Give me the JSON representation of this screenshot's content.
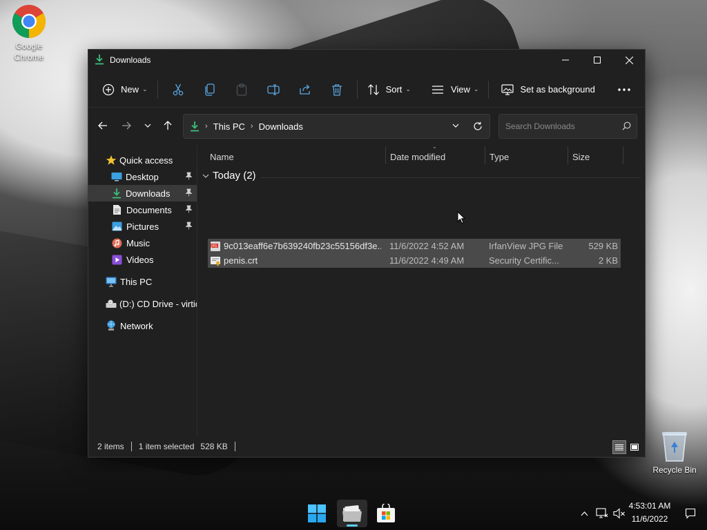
{
  "desktop": {
    "icons": [
      {
        "label": "Google Chrome"
      },
      {
        "label": "Recycle Bin"
      }
    ]
  },
  "window": {
    "title": "Downloads",
    "controls": {
      "minimize": "minimize",
      "maximize": "maximize",
      "close": "close"
    }
  },
  "toolbar": {
    "new_label": "New",
    "sort_label": "Sort",
    "view_label": "View",
    "set_background_label": "Set as background",
    "icons": [
      "cut-icon",
      "copy-icon",
      "paste-icon",
      "rename-icon",
      "share-icon",
      "delete-icon",
      "more-icon"
    ]
  },
  "navigation": {
    "breadcrumb": [
      "This PC",
      "Downloads"
    ],
    "search_placeholder": "Search Downloads"
  },
  "sidebar": {
    "quick_access": "Quick access",
    "items": [
      {
        "label": "Desktop",
        "pinned": true
      },
      {
        "label": "Downloads",
        "pinned": true,
        "selected": true
      },
      {
        "label": "Documents",
        "pinned": true
      },
      {
        "label": "Pictures",
        "pinned": true
      },
      {
        "label": "Music",
        "pinned": false
      },
      {
        "label": "Videos",
        "pinned": false
      }
    ],
    "this_pc": "This PC",
    "cd_drive": "(D:) CD Drive - virtio",
    "network": "Network"
  },
  "file_list": {
    "columns": [
      "Name",
      "Date modified",
      "Type",
      "Size"
    ],
    "group": "Today (2)",
    "rows": [
      {
        "name": "9c013eaff6e7b639240fb23c55156df3e...",
        "date": "11/6/2022 4:52 AM",
        "type": "IrfanView JPG File",
        "size": "529 KB",
        "icon": "jpg-file-icon"
      },
      {
        "name": "penis.crt",
        "date": "11/6/2022 4:49 AM",
        "type": "Security Certific...",
        "size": "2 KB",
        "icon": "certificate-file-icon"
      }
    ]
  },
  "status": {
    "items": "2 items",
    "selection": "1 item selected",
    "selection_size": "528 KB"
  },
  "taskbar": {
    "time": "4:53:01 AM",
    "date": "11/6/2022"
  },
  "colors": {
    "accent": "#60cdff",
    "window_bg": "#202020",
    "selection": "#4a4a4a",
    "download_green": "#3cc07a"
  }
}
